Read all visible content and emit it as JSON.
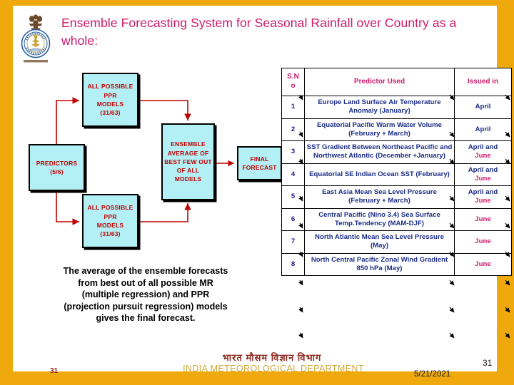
{
  "slide": {
    "title": "Ensemble Forecasting System for Seasonal Rainfall over Country as a whole:",
    "accent_border_color": "#EFA90D",
    "title_color": "#CC1A6B"
  },
  "emblem": {
    "name": "india-meteorological-department-emblem"
  },
  "flowchart": {
    "boxes": [
      {
        "id": "ppr-top",
        "lines": [
          "ALL POSSIBLE",
          "PPR",
          "MODELS",
          "(31/63)"
        ]
      },
      {
        "id": "predictors",
        "lines": [
          "PREDICTORS",
          "(5/6)"
        ]
      },
      {
        "id": "ppr-bottom",
        "lines": [
          "ALL POSSIBLE",
          "PPR",
          "MODELS",
          "(31/63)"
        ]
      },
      {
        "id": "ensemble",
        "lines": [
          "ENSEMBLE",
          "AVERAGE OF",
          "BEST FEW OUT",
          "OF ALL",
          "MODELS"
        ]
      },
      {
        "id": "final",
        "lines": [
          "FINAL",
          "FORECAST"
        ]
      }
    ],
    "box_fill": "#B3F0F5",
    "box_text_color": "#C00000",
    "arrow_color": "#C00000"
  },
  "caption": {
    "lines": [
      "The average of the ensemble forecasts",
      "from best out of all possible MR",
      "(multiple regression) and PPR",
      "(projection pursuit regression) models",
      "gives the final forecast."
    ]
  },
  "table": {
    "headers": {
      "sno": "S.No",
      "sno_line1": "S.N",
      "sno_line2": "o",
      "predictor": "Predictor Used",
      "issued": "Issued in"
    },
    "rows": [
      {
        "sno": "1",
        "predictor": "Europe Land Surface Air Temperature Anomaly (January)",
        "issued": "April",
        "issued_type": "april"
      },
      {
        "sno": "2",
        "predictor": "Equatorial Pacific  Warm Water Volume  (February + March)",
        "issued": "April",
        "issued_type": "april"
      },
      {
        "sno": "3",
        "predictor": "SST Gradient Between Northeast Pacific and Northwest  Atlantic (December +January)",
        "issued": "April and June",
        "issued_type": "april-and-june",
        "issued_part1": "April and",
        "issued_part2": "June"
      },
      {
        "sno": "4",
        "predictor": "Equatorial SE Indian Ocean SST (February)",
        "issued": "April and June",
        "issued_type": "april-and-june",
        "issued_part1": "April and",
        "issued_part2": "June"
      },
      {
        "sno": "5",
        "predictor": "East Asia Mean  Sea Level Pressure  (February + March)",
        "issued": "April and June",
        "issued_type": "april-and-june",
        "issued_part1": "April and",
        "issued_part2": "June"
      },
      {
        "sno": "6",
        "predictor": "Central Pacific (Nino 3.4)  Sea Surface Temp.Tendency (MAM-DJF)",
        "issued": "June",
        "issued_type": "june"
      },
      {
        "sno": "7",
        "predictor": "North Atlantic Mean Sea Level Pressure (May)",
        "issued": "June",
        "issued_type": "june"
      },
      {
        "sno": "8",
        "predictor": "North Central Pacific Zonal Wind Gradient  850 hPa (May)",
        "issued": "June",
        "issued_type": "june"
      }
    ],
    "colors": {
      "header_text": "#CC1A6B",
      "predictor_text": "#1B2C86",
      "april_text": "#1B2C86",
      "june_text": "#CC1A6B"
    }
  },
  "footer": {
    "hindi": "भारत मौसम विज्ञान विभाग",
    "english": "INDIA METEOROLOGICAL DEPARTMENT",
    "page_number_left": "31",
    "page_number_right": "31",
    "date": "5/21/2021"
  }
}
